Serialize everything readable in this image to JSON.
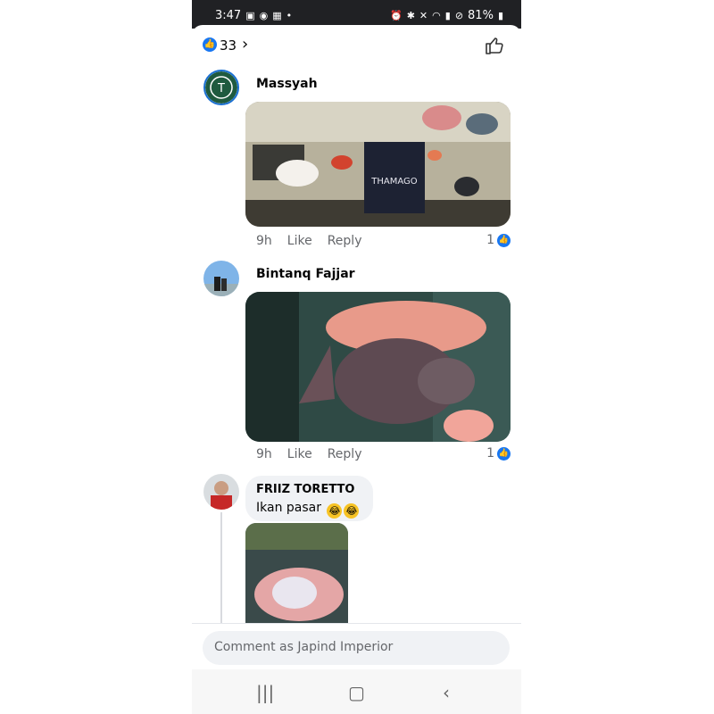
{
  "status_bar": {
    "time": "3:47",
    "left_icons": [
      "image-icon",
      "bluesky-icon",
      "gallery-icon"
    ],
    "battery": "81%"
  },
  "reactions": {
    "count": "33"
  },
  "comments": [
    {
      "author": "Massyah",
      "time": "9h",
      "like_label": "Like",
      "reply_label": "Reply",
      "reaction_count": "1",
      "media_text": "THAMAGO"
    },
    {
      "author": "Bintanq Fajjar",
      "time": "9h",
      "like_label": "Like",
      "reply_label": "Reply",
      "reaction_count": "1"
    },
    {
      "author": "FRIIZ TORETTO",
      "text": "Ikan pasar"
    }
  ],
  "composer": {
    "placeholder": "Comment as Japind Imperior"
  },
  "colors": {
    "accent": "#1877f2",
    "status_bar": "#202124"
  }
}
